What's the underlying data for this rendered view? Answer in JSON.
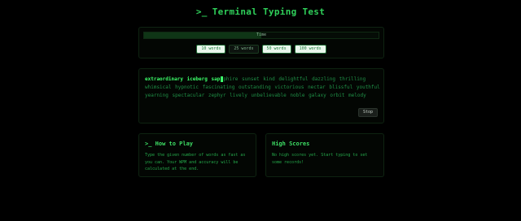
{
  "header": {
    "prompt_symbol": ">_",
    "title": "Terminal Typing Test"
  },
  "progress": {
    "label": "Time",
    "fraction": 0.5
  },
  "word_options": [
    {
      "label": "10 words",
      "active": false
    },
    {
      "label": "25 words",
      "active": true
    },
    {
      "label": "50 words",
      "active": false
    },
    {
      "label": "100 words",
      "active": false
    }
  ],
  "typing": {
    "typed_text": "extraordinary iceberg sapphire",
    "typed_full_word": "sapphire",
    "cursor_split_index": 3,
    "remaining_text": "sunset kind delightful dazzling thrilling whimsical hypnotic fascinating outstanding victorious nectar blissful youthful yearning spectacular zephyr lively unbelievable noble galaxy orbit melody",
    "stop_label": "Stop"
  },
  "how_to_play": {
    "title": ">_ How to Play",
    "body": "Type the given number of words as fast as you can. Your WPM and accuracy will be calculated at the end."
  },
  "high_scores": {
    "title": "High Scores",
    "body": "No high scores yet. Start typing to set some records!"
  },
  "colors": {
    "background": "#000000",
    "accent": "#2fd05a",
    "typed": "#3cff6a",
    "untyped": "#1f8f46"
  }
}
